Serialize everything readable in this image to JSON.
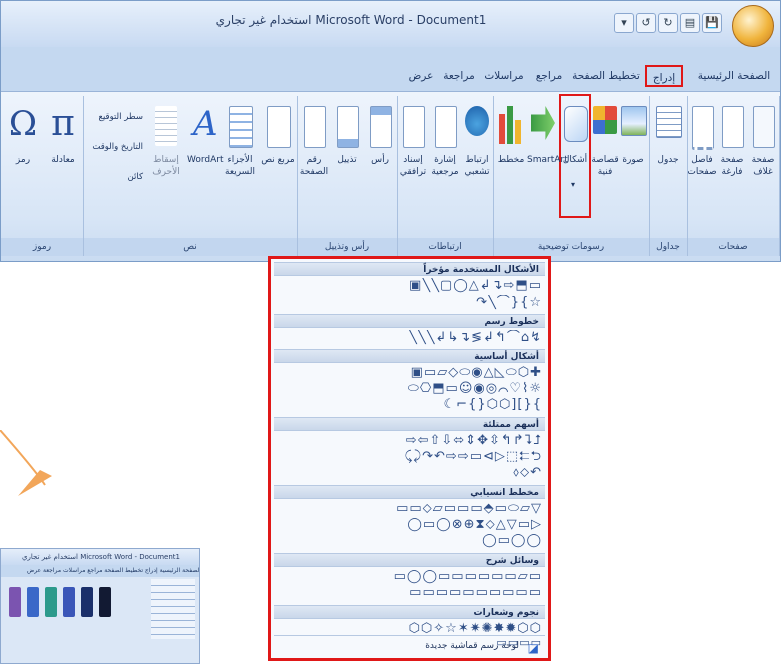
{
  "window": {
    "title": "استخدام غير تجاري Microsoft Word - Document1"
  },
  "tabs": [
    {
      "label": "الصفحة الرئيسية"
    },
    {
      "label": "إدراج"
    },
    {
      "label": "تخطيط الصفحة"
    },
    {
      "label": "مراجع"
    },
    {
      "label": "مراسلات"
    },
    {
      "label": "مراجعة"
    },
    {
      "label": "عرض"
    }
  ],
  "ribbon": {
    "groups": [
      {
        "label": "صفحات",
        "buttons": [
          "صفحة غلاف",
          "صفحة فارغة",
          "فاصل صفحات"
        ]
      },
      {
        "label": "جداول",
        "buttons": [
          "جدول"
        ]
      },
      {
        "label": "رسومات توضيحية",
        "buttons": [
          "صورة",
          "قصاصة فنية",
          "أشكال",
          "SmartArt",
          "مخطط"
        ]
      },
      {
        "label": "ارتباطات",
        "buttons": [
          "ارتباط تشعبي",
          "إشارة مرجعية",
          "إسناد ترافقي"
        ]
      },
      {
        "label": "رأس وتذييل",
        "buttons": [
          "رأس",
          "تذييل",
          "رقم الصفحة"
        ]
      },
      {
        "label": "نص",
        "buttons": [
          "مربع نص",
          "الأجزاء السريعة",
          "WordArt",
          "إسقاط الأحرف"
        ]
      },
      {
        "label": "رموز",
        "buttons": [
          "معادلة",
          "رمز"
        ]
      }
    ],
    "text_small": [
      "سطر التوقيع",
      "التاريخ والوقت",
      "كائن"
    ]
  },
  "dropdown": {
    "sections": [
      {
        "title": "الأشكال المستخدمة مؤخراً",
        "rows": [
          "▭⬒⇨↴↲△◯▢╲╲▣",
          "☆}{⌒╲↷"
        ]
      },
      {
        "title": "خطوط رسم",
        "rows": [
          "↯⌂⌒↰↲≷↴↳↲╲╲╲"
        ]
      },
      {
        "title": "أشكال أساسية",
        "rows": [
          "✚⬡⬭◺△◉⬭◇▱▭▣",
          "☼⌇♡⌒◎◉☺▭⬒⎔⬭",
          "}{][⬡⬡{}⌐☾"
        ]
      },
      {
        "title": "أسهم ممتلئة",
        "rows": [
          "⮥⮧↱↰⇳✥⇕⬄⇩⇧⇦⇨",
          "⮌⮄⬚▷⊳▭⇨⇨↶↷⤸⤹",
          "↶⬦⬨"
        ]
      },
      {
        "title": "مخطط انسيابي",
        "rows": [
          "▽▱⬭▭⬘▭▭▭▱⬦▭▭",
          "▷▭▽△⬦⧗⊕⊗◯▭◯",
          "◯◯▭◯"
        ]
      },
      {
        "title": "وسائل شرح",
        "rows": [
          "▭▱▭▭▭▭▭▭◯◯▭",
          "▭▭▭▭▭▭▭▭▭▭"
        ]
      },
      {
        "title": "نجوم وشعارات",
        "rows": [
          "⬡⬡✹✸✺✷✶☆✧⬡⬡",
          "▭▭▭▭"
        ]
      }
    ],
    "footer": "لوحة رسم قماشية جديدة"
  },
  "thumbnail": {
    "title": "استخدام غير تجاري Microsoft Word - Document1",
    "tabs": "الصفحة الرئيسية إدراج تخطيط الصفحة مراجع مراسلات مراجعة عرض"
  },
  "colors": {
    "highlight": "#e01818",
    "ribbon_bg": "#dbe7f6",
    "arrow": "#f2a65a"
  }
}
